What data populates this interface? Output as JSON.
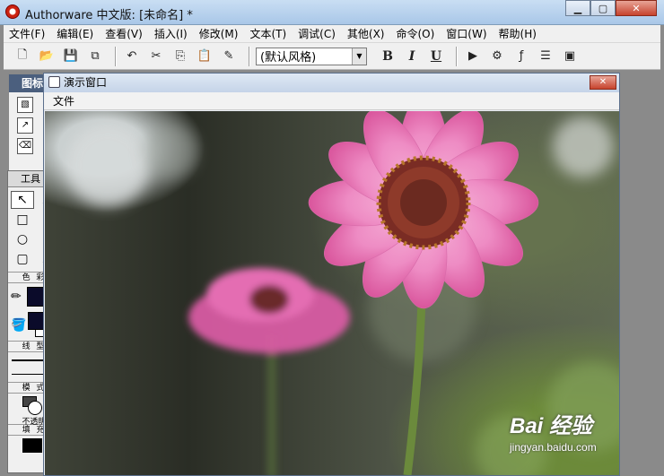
{
  "window": {
    "title": "Authorware 中文版: [未命名] *"
  },
  "menubar": [
    "文件(F)",
    "编辑(E)",
    "查看(V)",
    "插入(I)",
    "修改(M)",
    "文本(T)",
    "调试(C)",
    "其他(X)",
    "命令(O)",
    "窗口(W)",
    "帮助(H)"
  ],
  "toolbar": {
    "style_value": "(默认风格)",
    "bold": "B",
    "italic": "I",
    "underline": "U"
  },
  "icon_palette": {
    "title": "图标"
  },
  "tools": {
    "title": "工具",
    "color_label": "色 彩",
    "line_label": "线 型",
    "mode_label": "模 式",
    "mode_value": "不透明",
    "fill_label": "填 充",
    "colors": {
      "stroke": "#0b0b2a",
      "fill": "#0b0b2a",
      "background": "#ffffff"
    }
  },
  "presentation": {
    "title": "演示窗口",
    "menu_file": "文件"
  },
  "watermark": {
    "logo": "Bai 经验",
    "url": "jingyan.baidu.com"
  }
}
